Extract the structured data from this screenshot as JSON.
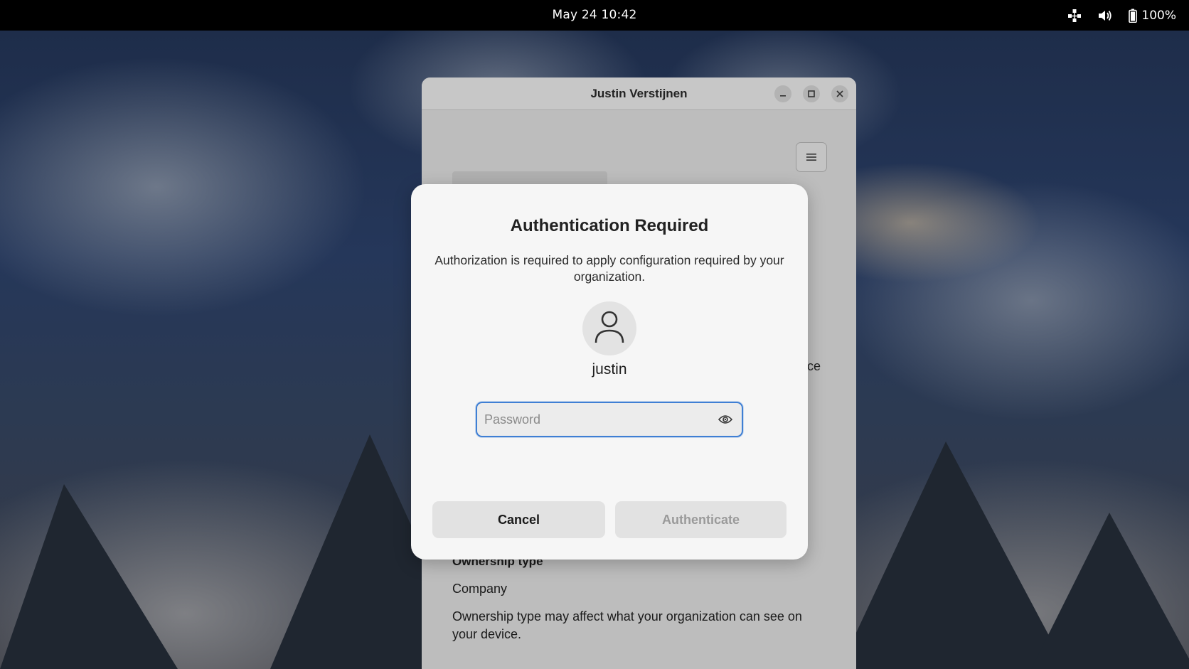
{
  "topbar": {
    "clock": "May 24  10:42",
    "battery_percent": "100%",
    "icons": [
      "network-icon",
      "volume-icon",
      "battery-icon"
    ]
  },
  "window": {
    "title": "Justin Verstijnen",
    "peek_text": "ce",
    "ownership_title": "Ownership type",
    "ownership_value": "Company",
    "ownership_description": "Ownership type may affect what your organization can see on your device."
  },
  "dialog": {
    "title": "Authentication Required",
    "message": "Authorization is required to apply configuration required by your organization.",
    "username": "justin",
    "password_placeholder": "Password",
    "password_value": "",
    "cancel_label": "Cancel",
    "authenticate_label": "Authenticate",
    "authenticate_enabled": false
  },
  "colors": {
    "accent": "#3f7fd4",
    "dialog_bg": "#f6f6f6",
    "topbar_bg": "#000000"
  }
}
